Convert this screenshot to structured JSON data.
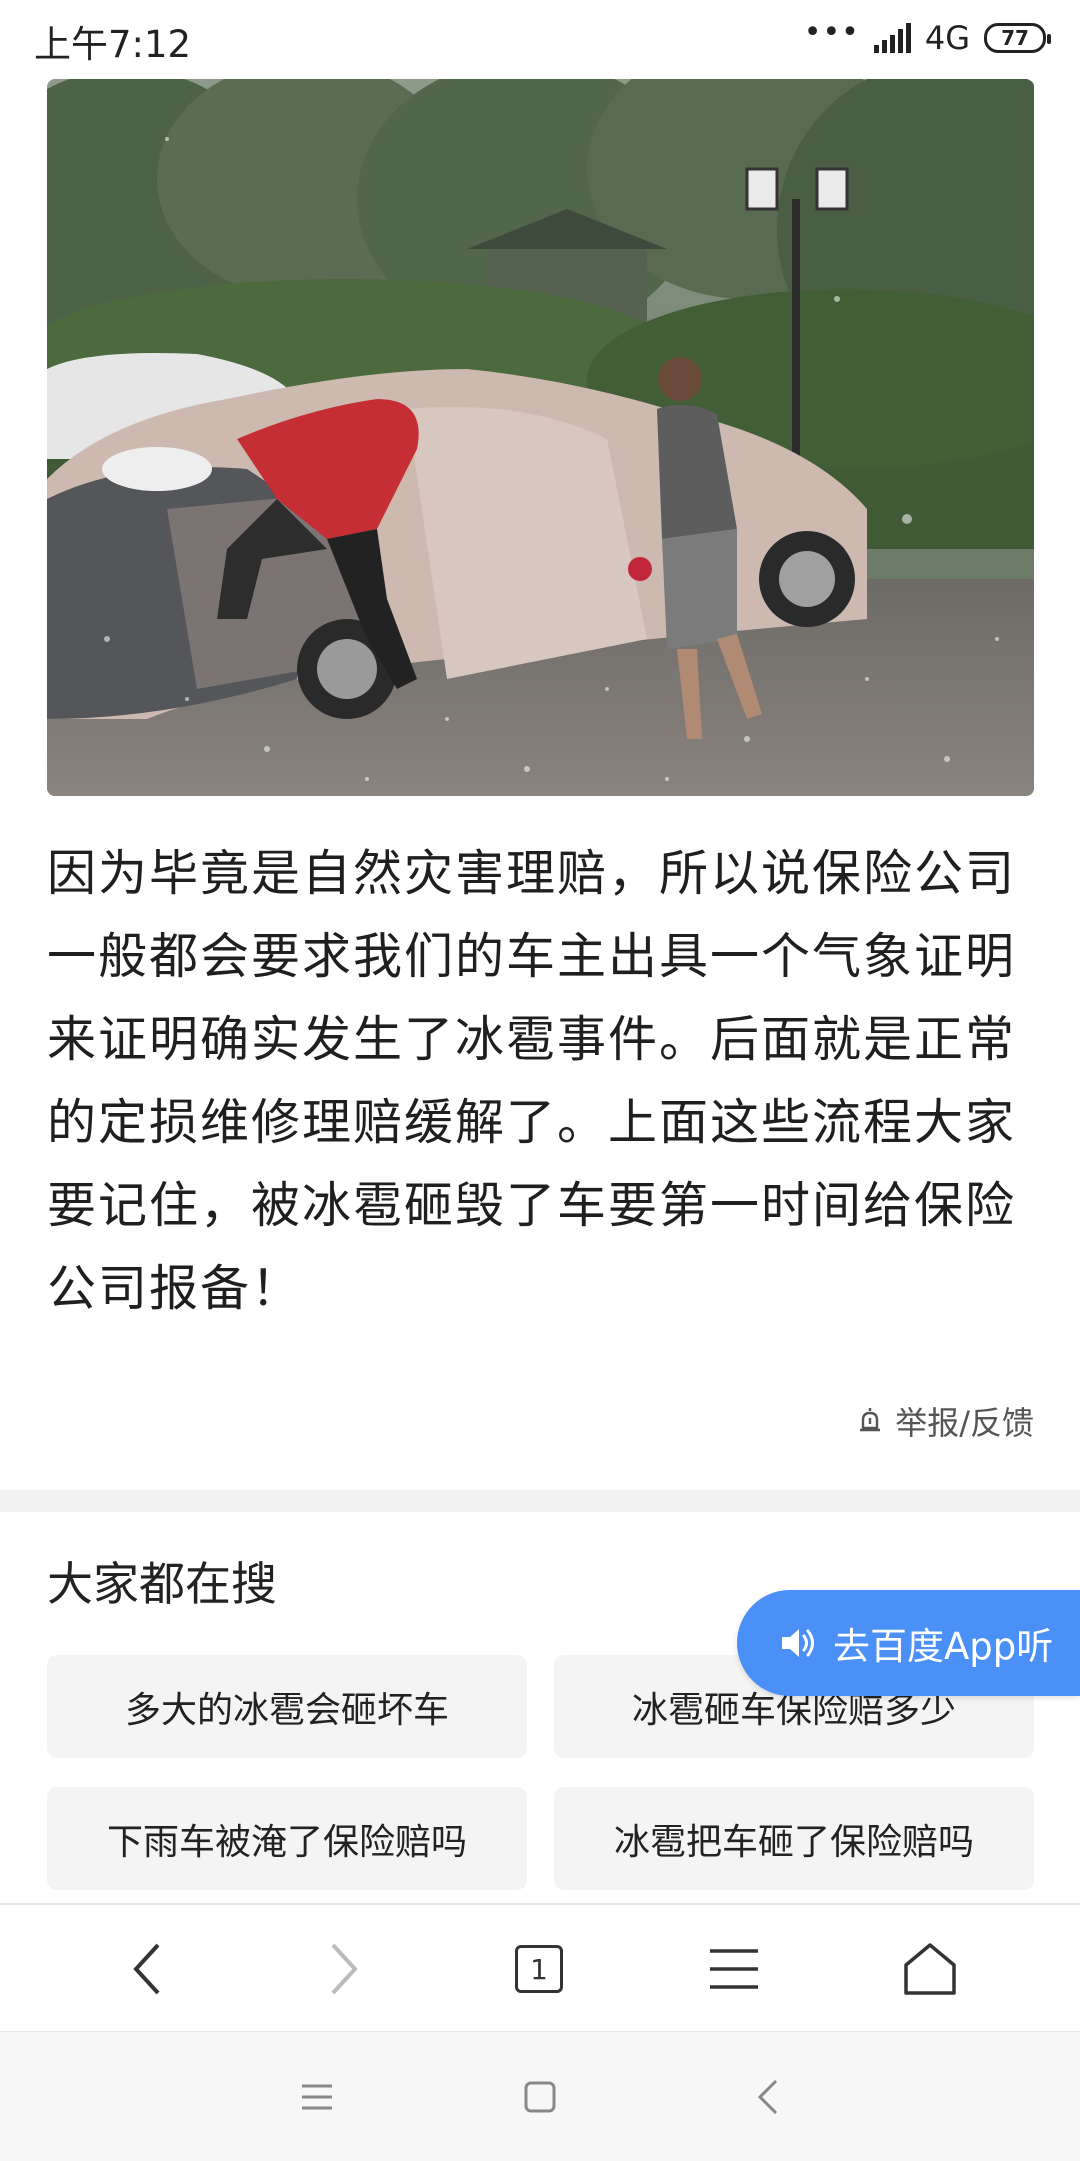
{
  "status_bar": {
    "time": "上午7:12",
    "network": "4G",
    "battery": "77"
  },
  "article": {
    "paragraph": "因为毕竟是自然灾害理赔，所以说保险公司一般都会要求我们的车主出具一个气象证明来证明确实发生了冰雹事件。后面就是正常的定损维修理赔缓解了。上面这些流程大家要记住，被冰雹砸毁了车要第一时间给保险公司报备！",
    "report_label": "举报/反馈"
  },
  "related": {
    "title": "大家都在搜",
    "items": [
      {
        "label": "多大的冰雹会砸坏车"
      },
      {
        "label": "冰雹砸车保险赔多少"
      },
      {
        "label": "下雨车被淹了保险赔吗"
      },
      {
        "label": "冰雹把车砸了保险赔吗"
      }
    ]
  },
  "listen_button": {
    "label": "去百度App听"
  },
  "browser_toolbar": {
    "tab_count": "1"
  },
  "icons": {
    "back": "chevron-left-icon",
    "forward": "chevron-right-icon",
    "tabs": "tabs-icon",
    "menu": "menu-icon",
    "home": "home-icon"
  },
  "colors": {
    "accent": "#4a90f7",
    "chip_bg": "#f4f4f4",
    "text": "#1f1f1f"
  }
}
